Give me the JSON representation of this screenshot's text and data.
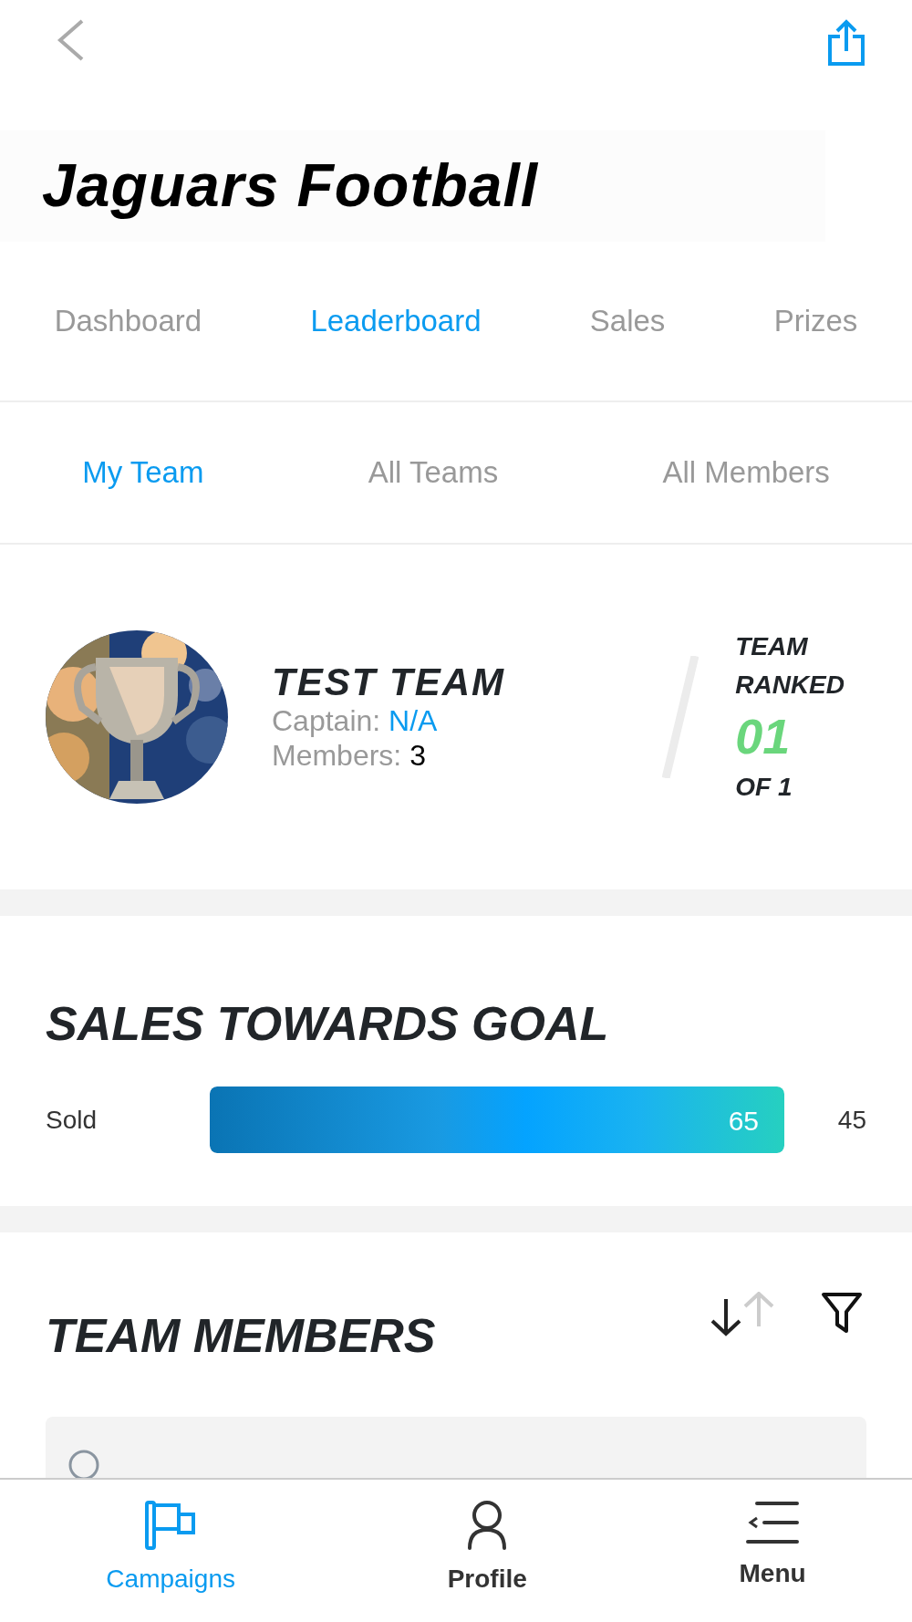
{
  "header": {
    "title": "Jaguars Football"
  },
  "tabs": [
    {
      "label": "Dashboard",
      "selected": false
    },
    {
      "label": "Leaderboard",
      "selected": true
    },
    {
      "label": "Sales",
      "selected": false
    },
    {
      "label": "Prizes",
      "selected": false
    }
  ],
  "subtabs": [
    {
      "label": "My Team",
      "selected": true
    },
    {
      "label": "All Teams",
      "selected": false
    },
    {
      "label": "All Members",
      "selected": false
    }
  ],
  "team": {
    "name": "TEST TEAM",
    "captain_label": "Captain:",
    "captain": "N/A",
    "members_label": "Members:",
    "members": "3",
    "rank_label_1": "TEAM",
    "rank_label_2": "RANKED",
    "rank": "01",
    "rank_of": "OF 1"
  },
  "sales": {
    "title": "SALES TOWARDS GOAL",
    "label": "Sold",
    "value": "65",
    "level": 1,
    "goal": "45"
  },
  "members": {
    "title": "TEAM MEMBERS"
  },
  "nav": [
    {
      "label": "Campaigns",
      "selected": true
    },
    {
      "label": "Profile",
      "selected": false
    },
    {
      "label": "Menu",
      "selected": false
    }
  ]
}
